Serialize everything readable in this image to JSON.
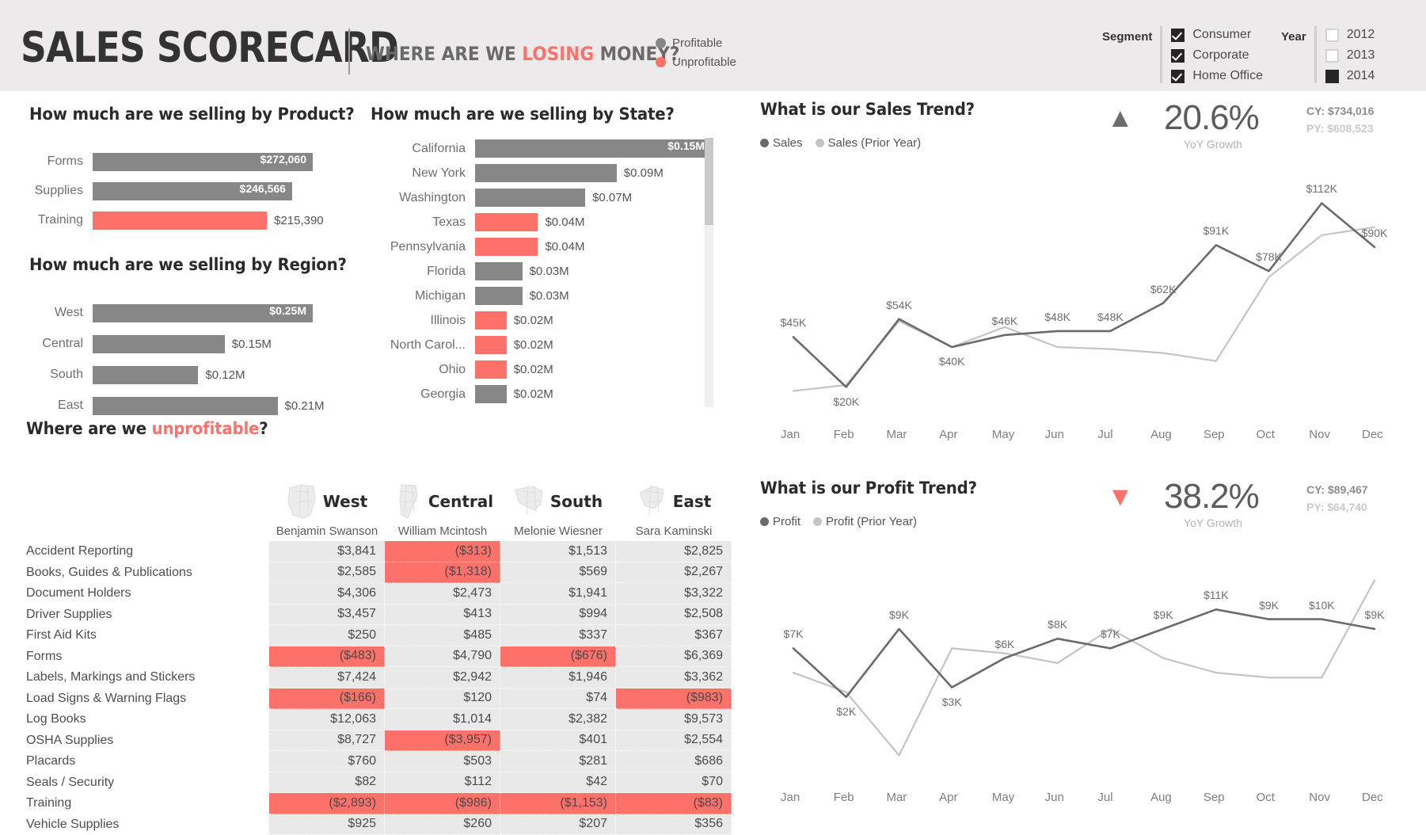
{
  "header": {
    "title": "SALES SCORECARD",
    "subtitle_pre": "WHERE ARE WE ",
    "subtitle_hl": "LOSING",
    "subtitle_post": " MONEY?",
    "legend": [
      {
        "label": "Profitable",
        "color": "#878787"
      },
      {
        "label": "Unprofitable",
        "color": "#fc7169"
      }
    ],
    "segment_slicer": {
      "title": "Segment",
      "options": [
        {
          "label": "Consumer",
          "state": "checked"
        },
        {
          "label": "Corporate",
          "state": "checked"
        },
        {
          "label": "Home Office",
          "state": "checked"
        }
      ]
    },
    "year_slicer": {
      "title": "Year",
      "options": [
        {
          "label": "2012",
          "state": "empty"
        },
        {
          "label": "2013",
          "state": "empty"
        },
        {
          "label": "2014",
          "state": "filled"
        }
      ]
    }
  },
  "product_chart": {
    "title": "How much are we selling by Product?",
    "chart_data": {
      "type": "bar",
      "title": "How much are we selling by Product?",
      "orientation": "horizontal",
      "categories": [
        "Forms",
        "Supplies",
        "Training"
      ],
      "values": [
        272060,
        246566,
        215390
      ],
      "labels": [
        "$272,060",
        "$246,566",
        "$215,390"
      ],
      "profitable": [
        true,
        true,
        false
      ],
      "label_inside": [
        true,
        true,
        false
      ],
      "xlabel": "",
      "ylabel": "",
      "grid": false
    }
  },
  "region_chart": {
    "title": "How much are we selling by Region?",
    "chart_data": {
      "type": "bar",
      "title": "How much are we selling by Region?",
      "orientation": "horizontal",
      "categories": [
        "West",
        "Central",
        "South",
        "East"
      ],
      "values": [
        0.25,
        0.15,
        0.12,
        0.21
      ],
      "labels": [
        "$0.25M",
        "$0.15M",
        "$0.12M",
        "$0.21M"
      ],
      "profitable": [
        true,
        true,
        true,
        true
      ],
      "label_inside": [
        true,
        false,
        false,
        false
      ],
      "unit": "M",
      "xlabel": "",
      "ylabel": "",
      "grid": false
    }
  },
  "state_chart": {
    "title": "How much are we selling by State?",
    "chart_data": {
      "type": "bar",
      "title": "How much are we selling by State?",
      "orientation": "horizontal",
      "categories": [
        "California",
        "New York",
        "Washington",
        "Texas",
        "Pennsylvania",
        "Florida",
        "Michigan",
        "Illinois",
        "North Carol...",
        "Ohio",
        "Georgia"
      ],
      "values": [
        0.15,
        0.09,
        0.07,
        0.04,
        0.04,
        0.03,
        0.03,
        0.02,
        0.02,
        0.02,
        0.02
      ],
      "labels": [
        "$0.15M",
        "$0.09M",
        "$0.07M",
        "$0.04M",
        "$0.04M",
        "$0.03M",
        "$0.03M",
        "$0.02M",
        "$0.02M",
        "$0.02M",
        "$0.02M"
      ],
      "profitable": [
        true,
        true,
        true,
        false,
        false,
        true,
        true,
        false,
        false,
        false,
        true
      ],
      "label_inside": [
        true,
        false,
        false,
        false,
        false,
        false,
        false,
        false,
        false,
        false,
        false
      ],
      "unit": "M",
      "xlabel": "",
      "ylabel": "",
      "grid": false,
      "scrollable": true
    }
  },
  "matrix": {
    "title_pre": "Where are we ",
    "title_hl": "unprofitable",
    "title_post": "?",
    "columns": [
      {
        "region": "West",
        "person": "Benjamin Swanson",
        "icon": "us-map-west-icon"
      },
      {
        "region": "Central",
        "person": "William Mcintosh",
        "icon": "us-map-central-icon"
      },
      {
        "region": "South",
        "person": "Melonie Wiesner",
        "icon": "us-map-south-icon"
      },
      {
        "region": "East",
        "person": "Sara Kaminski",
        "icon": "us-map-east-icon"
      }
    ],
    "rows": [
      {
        "name": "Accident Reporting",
        "cells": [
          {
            "v": "$3,841",
            "neg": false
          },
          {
            "v": "($313)",
            "neg": true
          },
          {
            "v": "$1,513",
            "neg": false
          },
          {
            "v": "$2,825",
            "neg": false
          }
        ]
      },
      {
        "name": "Books, Guides & Publications",
        "cells": [
          {
            "v": "$2,585",
            "neg": false
          },
          {
            "v": "($1,318)",
            "neg": true
          },
          {
            "v": "$569",
            "neg": false
          },
          {
            "v": "$2,267",
            "neg": false
          }
        ]
      },
      {
        "name": "Document Holders",
        "cells": [
          {
            "v": "$4,306",
            "neg": false
          },
          {
            "v": "$2,473",
            "neg": false
          },
          {
            "v": "$1,941",
            "neg": false
          },
          {
            "v": "$3,322",
            "neg": false
          }
        ]
      },
      {
        "name": "Driver Supplies",
        "cells": [
          {
            "v": "$3,457",
            "neg": false
          },
          {
            "v": "$413",
            "neg": false
          },
          {
            "v": "$994",
            "neg": false
          },
          {
            "v": "$2,508",
            "neg": false
          }
        ]
      },
      {
        "name": "First Aid Kits",
        "cells": [
          {
            "v": "$250",
            "neg": false
          },
          {
            "v": "$485",
            "neg": false
          },
          {
            "v": "$337",
            "neg": false
          },
          {
            "v": "$367",
            "neg": false
          }
        ]
      },
      {
        "name": "Forms",
        "cells": [
          {
            "v": "($483)",
            "neg": true
          },
          {
            "v": "$4,790",
            "neg": false
          },
          {
            "v": "($676)",
            "neg": true
          },
          {
            "v": "$6,369",
            "neg": false
          }
        ]
      },
      {
        "name": "Labels, Markings and Stickers",
        "cells": [
          {
            "v": "$7,424",
            "neg": false
          },
          {
            "v": "$2,942",
            "neg": false
          },
          {
            "v": "$1,946",
            "neg": false
          },
          {
            "v": "$3,362",
            "neg": false
          }
        ]
      },
      {
        "name": "Load Signs & Warning Flags",
        "cells": [
          {
            "v": "($166)",
            "neg": true
          },
          {
            "v": "$120",
            "neg": false
          },
          {
            "v": "$74",
            "neg": false
          },
          {
            "v": "($983)",
            "neg": true
          }
        ]
      },
      {
        "name": "Log Books",
        "cells": [
          {
            "v": "$12,063",
            "neg": false
          },
          {
            "v": "$1,014",
            "neg": false
          },
          {
            "v": "$2,382",
            "neg": false
          },
          {
            "v": "$9,573",
            "neg": false
          }
        ]
      },
      {
        "name": "OSHA Supplies",
        "cells": [
          {
            "v": "$8,727",
            "neg": false
          },
          {
            "v": "($3,957)",
            "neg": true
          },
          {
            "v": "$401",
            "neg": false
          },
          {
            "v": "$2,554",
            "neg": false
          }
        ]
      },
      {
        "name": "Placards",
        "cells": [
          {
            "v": "$760",
            "neg": false
          },
          {
            "v": "$503",
            "neg": false
          },
          {
            "v": "$281",
            "neg": false
          },
          {
            "v": "$686",
            "neg": false
          }
        ]
      },
      {
        "name": "Seals / Security",
        "cells": [
          {
            "v": "$82",
            "neg": false
          },
          {
            "v": "$112",
            "neg": false
          },
          {
            "v": "$42",
            "neg": false
          },
          {
            "v": "$70",
            "neg": false
          }
        ]
      },
      {
        "name": "Training",
        "cells": [
          {
            "v": "($2,893)",
            "neg": true
          },
          {
            "v": "($986)",
            "neg": true
          },
          {
            "v": "($1,153)",
            "neg": true
          },
          {
            "v": "($83)",
            "neg": true
          }
        ]
      },
      {
        "name": "Vehicle Supplies",
        "cells": [
          {
            "v": "$925",
            "neg": false
          },
          {
            "v": "$260",
            "neg": false
          },
          {
            "v": "$207",
            "neg": false
          },
          {
            "v": "$356",
            "neg": false
          }
        ]
      }
    ]
  },
  "sales_trend": {
    "title": "What is our Sales Trend?",
    "kpi": {
      "arrow": "up",
      "pct": "20.6%",
      "sub": "YoY Growth",
      "cy": "CY: $734,016",
      "py": "PY: $608,523"
    },
    "chart_data": {
      "type": "line",
      "title": "What is our Sales Trend?",
      "x": [
        "Jan",
        "Feb",
        "Mar",
        "Apr",
        "May",
        "Jun",
        "Jul",
        "Aug",
        "Sep",
        "Oct",
        "Nov",
        "Dec"
      ],
      "xlabel": "",
      "ylabel": "",
      "grid": false,
      "legend_position": "top-left",
      "series": [
        {
          "name": "Sales",
          "color": "#6b6b6b",
          "values": [
            45,
            20,
            54,
            40,
            46,
            48,
            48,
            62,
            91,
            78,
            112,
            90
          ],
          "labels": [
            "$45K",
            "$20K",
            "$54K",
            "$40K",
            "$46K",
            "$48K",
            "$48K",
            "$62K",
            "$91K",
            "$78K",
            "$112K",
            "$90K"
          ]
        },
        {
          "name": "Sales (Prior Year)",
          "color": "#c4c4c4",
          "values": [
            18,
            21,
            53,
            40,
            50,
            40,
            39,
            37,
            33,
            75,
            96,
            100
          ],
          "labels": []
        }
      ]
    }
  },
  "profit_trend": {
    "title": "What is our Profit Trend?",
    "kpi": {
      "arrow": "down",
      "pct": "38.2%",
      "sub": "YoY Growth",
      "cy": "CY: $89,467",
      "py": "PY: $64,740"
    },
    "chart_data": {
      "type": "line",
      "title": "What is our Profit Trend?",
      "x": [
        "Jan",
        "Feb",
        "Mar",
        "Apr",
        "May",
        "Jun",
        "Jul",
        "Aug",
        "Sep",
        "Oct",
        "Nov",
        "Dec"
      ],
      "xlabel": "",
      "ylabel": "",
      "grid": false,
      "legend_position": "top-left",
      "series": [
        {
          "name": "Profit",
          "color": "#6b6b6b",
          "values": [
            7,
            2,
            9,
            3,
            6,
            8,
            7,
            9,
            11,
            10,
            10,
            9
          ],
          "labels": [
            "$7K",
            "$2K",
            "$9K",
            "$3K",
            "$6K",
            "$8K",
            "$7K",
            "$9K",
            "$11K",
            "$9K",
            "$10K",
            "$9K"
          ]
        },
        {
          "name": "Profit (Prior Year)",
          "color": "#c4c4c4",
          "values": [
            4.5,
            2.5,
            -4,
            7,
            6.5,
            5.5,
            9,
            6,
            4.5,
            4,
            4,
            14
          ],
          "labels": []
        }
      ]
    }
  }
}
